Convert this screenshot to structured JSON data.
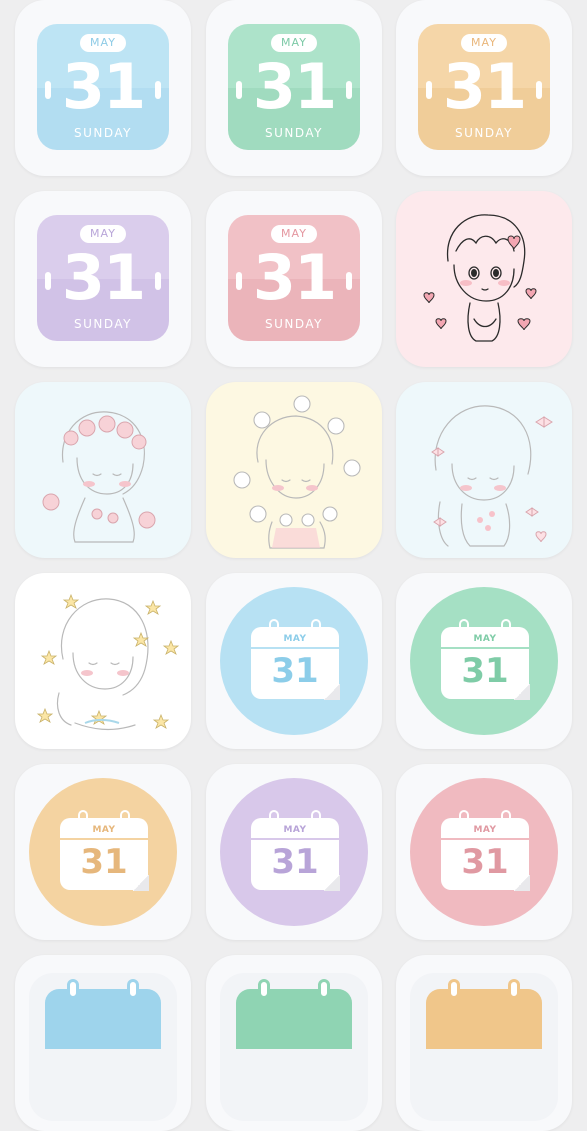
{
  "date": {
    "month": "MAY",
    "day": "31",
    "weekday": "SUNDAY"
  },
  "flip_icons": [
    {
      "name": "flip-calendar-blue",
      "top": "#b8e2f2",
      "bottom": "#b0dcf0",
      "month_color": "#8ecbe6"
    },
    {
      "name": "flip-calendar-green",
      "top": "#a6e0c6",
      "bottom": "#9bd9bd",
      "month_color": "#7cc9a6"
    },
    {
      "name": "flip-calendar-orange",
      "top": "#f4d3a3",
      "bottom": "#f0cc98",
      "month_color": "#e9b67a"
    },
    {
      "name": "flip-calendar-purple",
      "top": "#d7c9ea",
      "bottom": "#d0c1e6",
      "month_color": "#b9a6d9"
    },
    {
      "name": "flip-calendar-pink",
      "top": "#f0bcc2",
      "bottom": "#ebb3ba",
      "month_color": "#e497a0"
    }
  ],
  "circle_icons": [
    {
      "name": "circle-calendar-blue",
      "bg": "#b7e1f3",
      "accent": "#8ccde9"
    },
    {
      "name": "circle-calendar-green",
      "bg": "#a5e0c4",
      "accent": "#7fcca7"
    },
    {
      "name": "circle-calendar-orange",
      "bg": "#f4d3a1",
      "accent": "#e6b77c"
    },
    {
      "name": "circle-calendar-purple",
      "bg": "#d8c8ea",
      "accent": "#b8a4d8"
    },
    {
      "name": "circle-calendar-pink",
      "bg": "#f0bac0",
      "accent": "#e099a2"
    }
  ],
  "illustration_icons": [
    {
      "name": "girl-hearts-illustration",
      "bg": "#fde9ec"
    },
    {
      "name": "girl-flower-crown-illustration",
      "bg": "#eef8fb"
    },
    {
      "name": "girl-flowers-illustration",
      "bg": "#fdf8e2"
    },
    {
      "name": "girl-ribbons-illustration",
      "bg": "#eef8fb"
    },
    {
      "name": "girl-stars-illustration",
      "bg": "#ffffff"
    }
  ],
  "partial_icons": [
    {
      "name": "square-calendar-blue",
      "accent": "#9ed4ec"
    },
    {
      "name": "square-calendar-green",
      "accent": "#8fd4b3"
    },
    {
      "name": "square-calendar-orange",
      "accent": "#f0c68a"
    }
  ]
}
